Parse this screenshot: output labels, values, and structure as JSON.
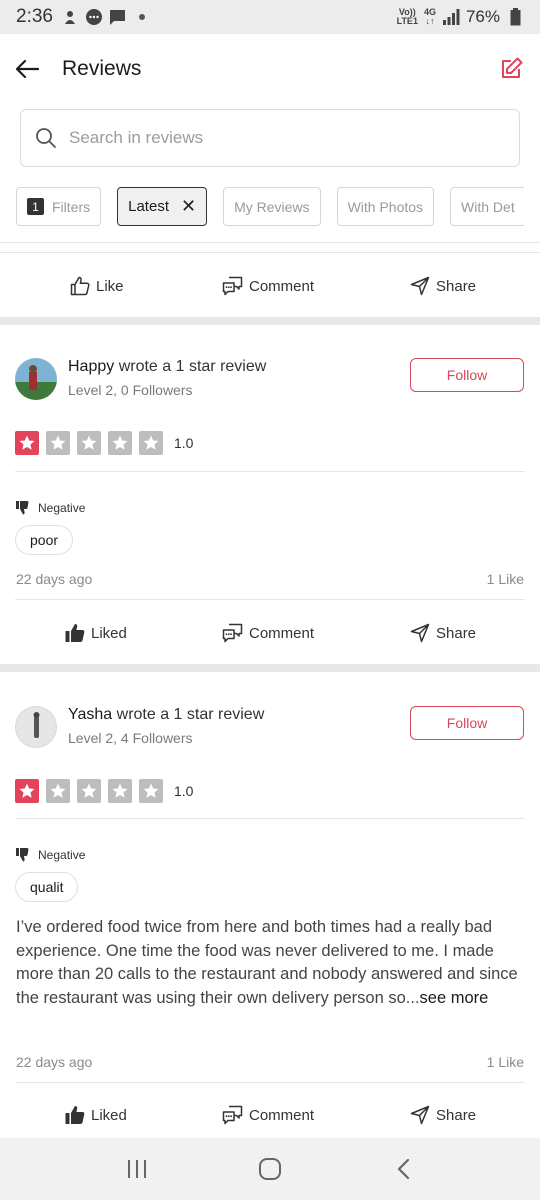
{
  "status_bar": {
    "time": "2:36",
    "network_top": "Vo))",
    "network_bottom": "LTE1",
    "net_type_top": "4G",
    "net_type_bottom": "↓↑",
    "battery": "76%"
  },
  "header": {
    "title": "Reviews"
  },
  "search": {
    "placeholder": "Search in reviews"
  },
  "filters": {
    "count": "1",
    "filters_label": "Filters",
    "latest_label": "Latest",
    "latest_close": "✕",
    "my_reviews": "My Reviews",
    "with_photos": "With Photos",
    "with_details": "With Det"
  },
  "actions": {
    "like": "Like",
    "liked": "Liked",
    "comment": "Comment",
    "share": "Share"
  },
  "reviews": [
    {
      "author": "Happy",
      "action": "wrote a 1 star review",
      "meta": "Level 2, 0 Followers",
      "follow": "Follow",
      "rating": "1.0",
      "rating_value": 1,
      "sentiment": "Negative",
      "tag": "poor",
      "time_ago": "22 days ago",
      "likes": "1 Like"
    },
    {
      "author": "Yasha",
      "action": "wrote a 1 star review",
      "meta": "Level 2, 4 Followers",
      "follow": "Follow",
      "rating": "1.0",
      "rating_value": 1,
      "sentiment": "Negative",
      "tag": "qualit",
      "text": "I’ve ordered food twice from here and both times had a really bad experience. One time the food was never delivered to me. I made more than 20 calls to the restaurant and nobody answered and since the restaurant was using their own delivery person so...",
      "see_more": "see more",
      "time_ago": "22 days ago",
      "likes": "1 Like"
    }
  ],
  "colors": {
    "accent": "#e2445c",
    "follow": "#d9475a"
  }
}
